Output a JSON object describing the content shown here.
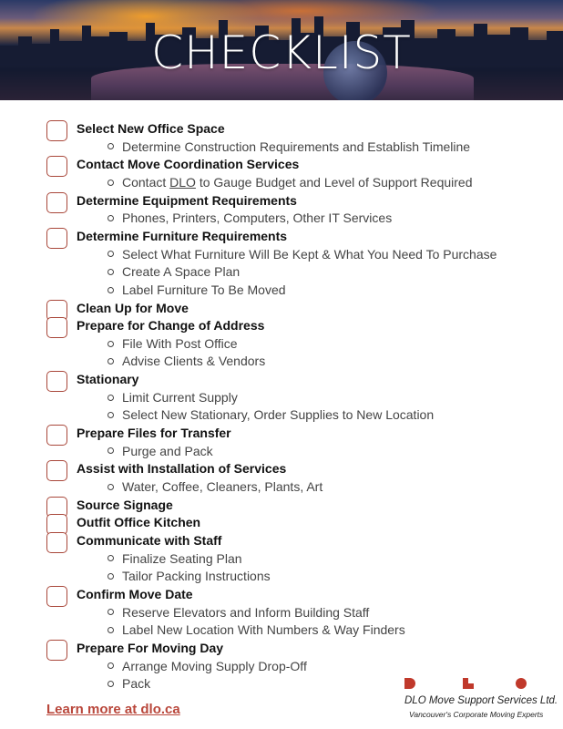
{
  "header": {
    "title": "CHECKLIST"
  },
  "checklist": [
    {
      "title": "Select New Office Space",
      "subitems": [
        "Determine Construction Requirements and Establish Timeline"
      ]
    },
    {
      "title": "Contact Move Coordination Services",
      "subitems": [
        {
          "pre": "Contact ",
          "link": "DLO",
          "post": " to Gauge Budget and Level of Support Required"
        }
      ]
    },
    {
      "title": "Determine Equipment Requirements",
      "subitems": [
        "Phones, Printers, Computers, Other IT Services"
      ]
    },
    {
      "title": "Determine Furniture Requirements",
      "subitems": [
        "Select What Furniture Will Be Kept & What You Need To Purchase",
        "Create A Space Plan",
        "Label Furniture To Be Moved"
      ]
    },
    {
      "title": "Clean Up for Move",
      "subitems": []
    },
    {
      "title": "Prepare for Change of Address",
      "subitems": [
        "File With Post Office",
        "Advise Clients & Vendors"
      ]
    },
    {
      "title": "Stationary",
      "subitems": [
        "Limit Current Supply",
        "Select New Stationary, Order Supplies to New Location"
      ]
    },
    {
      "title": "Prepare Files for Transfer",
      "subitems": [
        "Purge and Pack"
      ]
    },
    {
      "title": "Assist with Installation of Services",
      "subitems": [
        "Water, Coffee, Cleaners, Plants, Art"
      ]
    },
    {
      "title": "Source Signage",
      "subitems": []
    },
    {
      "title": "Outfit Office Kitchen",
      "subitems": []
    },
    {
      "title": "Communicate with Staff",
      "subitems": [
        "Finalize Seating Plan",
        "Tailor Packing Instructions"
      ]
    },
    {
      "title": "Confirm Move Date",
      "subitems": [
        "Reserve Elevators and Inform Building Staff",
        "Label New Location With Numbers & Way Finders"
      ]
    },
    {
      "title": "Prepare For Moving Day",
      "subitems": [
        "Arrange Moving Supply Drop-Off",
        "Pack"
      ]
    }
  ],
  "footer": {
    "learn_more": "Learn more at dlo.ca",
    "company": "DLO Move Support Services Ltd.",
    "tagline": "Vancouver's Corporate Moving Experts",
    "logo_letters": [
      "D",
      "L",
      "O"
    ],
    "brand_color": "#c0392b",
    "checkbox_color": "#a9473a"
  }
}
